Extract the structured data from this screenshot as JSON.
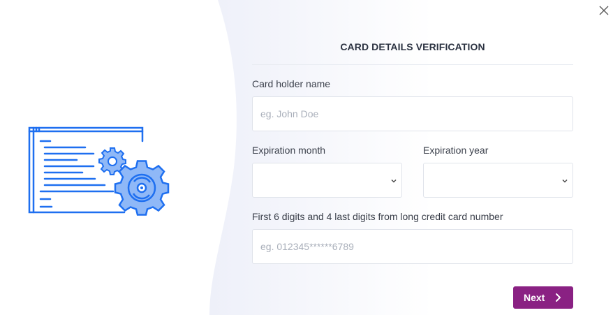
{
  "dialog": {
    "title": "CARD DETAILS VERIFICATION",
    "close_icon": "close-icon"
  },
  "illustration": {
    "icon": "code-window-with-gears-icon",
    "color": "#1e6ff0"
  },
  "form": {
    "card_holder": {
      "label": "Card holder name",
      "value": "",
      "placeholder": "eg. John Doe"
    },
    "expiration_month": {
      "label": "Expiration month",
      "value": ""
    },
    "expiration_year": {
      "label": "Expiration year",
      "value": ""
    },
    "card_digits": {
      "label": "First 6 digits and 4 last digits from long credit card number",
      "value": "",
      "placeholder": "eg. 012345******6789"
    }
  },
  "actions": {
    "next_label": "Next",
    "next_color": "#8a2183"
  }
}
